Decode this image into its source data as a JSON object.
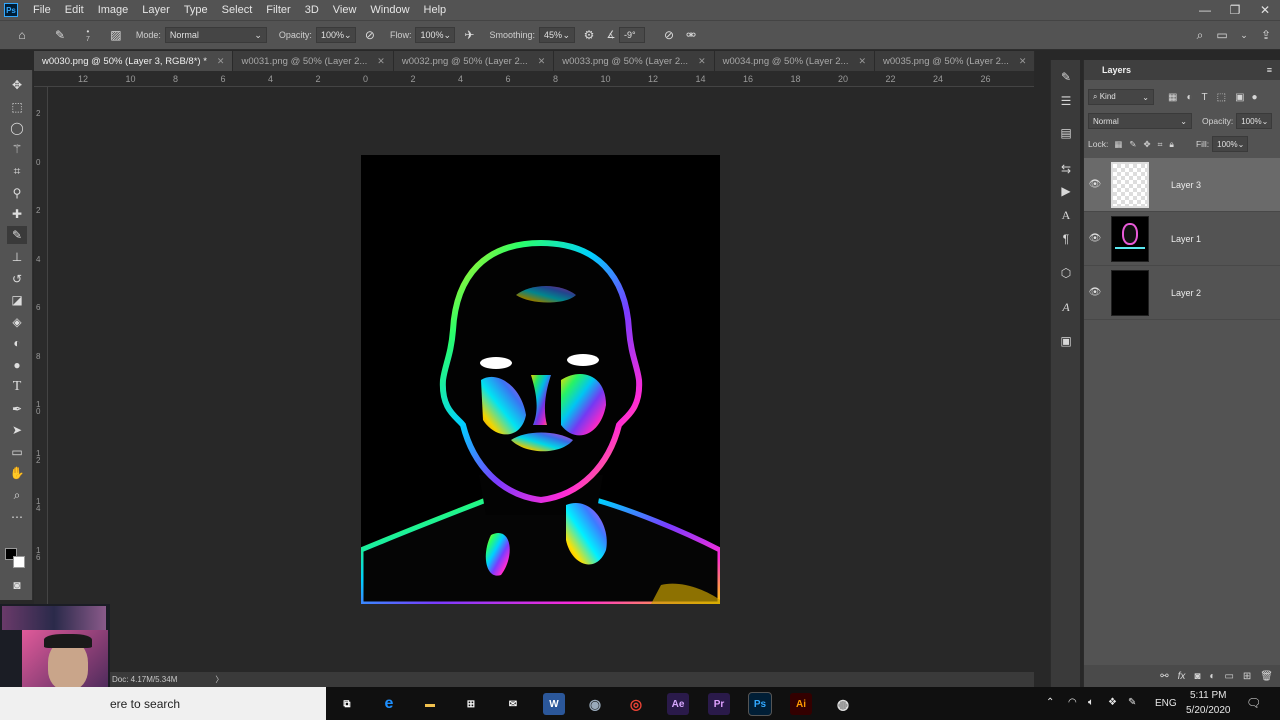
{
  "app": {
    "logo": "Ps"
  },
  "menu": [
    "File",
    "Edit",
    "Image",
    "Layer",
    "Type",
    "Select",
    "Filter",
    "3D",
    "View",
    "Window",
    "Help"
  ],
  "window_controls": {
    "minimize": "—",
    "restore": "❐",
    "close": "✕"
  },
  "options": {
    "brush_size": "7",
    "mode_label": "Mode:",
    "mode_value": "Normal",
    "opacity_label": "Opacity:",
    "opacity_value": "100%",
    "flow_label": "Flow:",
    "flow_value": "100%",
    "smoothing_label": "Smoothing:",
    "smoothing_value": "45%",
    "angle_value": "-9°"
  },
  "tabs": [
    {
      "label": "w0030.png @ 50% (Layer 3, RGB/8*) *",
      "active": true
    },
    {
      "label": "w0031.png @ 50% (Layer 2...",
      "active": false
    },
    {
      "label": "w0032.png @ 50% (Layer 2...",
      "active": false
    },
    {
      "label": "w0033.png @ 50% (Layer 2...",
      "active": false
    },
    {
      "label": "w0034.png @ 50% (Layer 2...",
      "active": false
    },
    {
      "label": "w0035.png @ 50% (Layer 2...",
      "active": false
    }
  ],
  "ruler_top": [
    "12",
    "10",
    "8",
    "6",
    "4",
    "2",
    "0",
    "2",
    "4",
    "6",
    "8",
    "10",
    "12",
    "14",
    "16",
    "18",
    "20",
    "22",
    "24",
    "26"
  ],
  "ruler_left": [
    "2",
    "0",
    "2",
    "4",
    "6",
    "8",
    "1 0",
    "1 2",
    "1 4",
    "1 6"
  ],
  "status": {
    "doc": "Doc: 4.17M/5.34M",
    "arrow": "〉"
  },
  "layers_panel": {
    "title": "Layers",
    "filter_kind": "Kind",
    "blend_mode": "Normal",
    "opacity_label": "Opacity:",
    "opacity_value": "100%",
    "lock_label": "Lock:",
    "fill_label": "Fill:",
    "fill_value": "100%",
    "layers": [
      {
        "name": "Layer 3",
        "selected": true,
        "thumb": "transparent"
      },
      {
        "name": "Layer 1",
        "selected": false,
        "thumb": "face"
      },
      {
        "name": "Layer 2",
        "selected": false,
        "thumb": "black"
      }
    ]
  },
  "taskbar": {
    "search_text": "ere to search",
    "apps": [
      {
        "name": "Ae",
        "color": "#2a1a4a",
        "fg": "#d8a8ff"
      },
      {
        "name": "Pr",
        "color": "#2a1a4a",
        "fg": "#e0a0ff"
      },
      {
        "name": "Ps",
        "color": "#001e36",
        "fg": "#31a8ff"
      },
      {
        "name": "Ai",
        "color": "#330000",
        "fg": "#ff9a00"
      }
    ],
    "lang": "ENG",
    "time": "5:11 PM",
    "date": "5/20/2020"
  }
}
